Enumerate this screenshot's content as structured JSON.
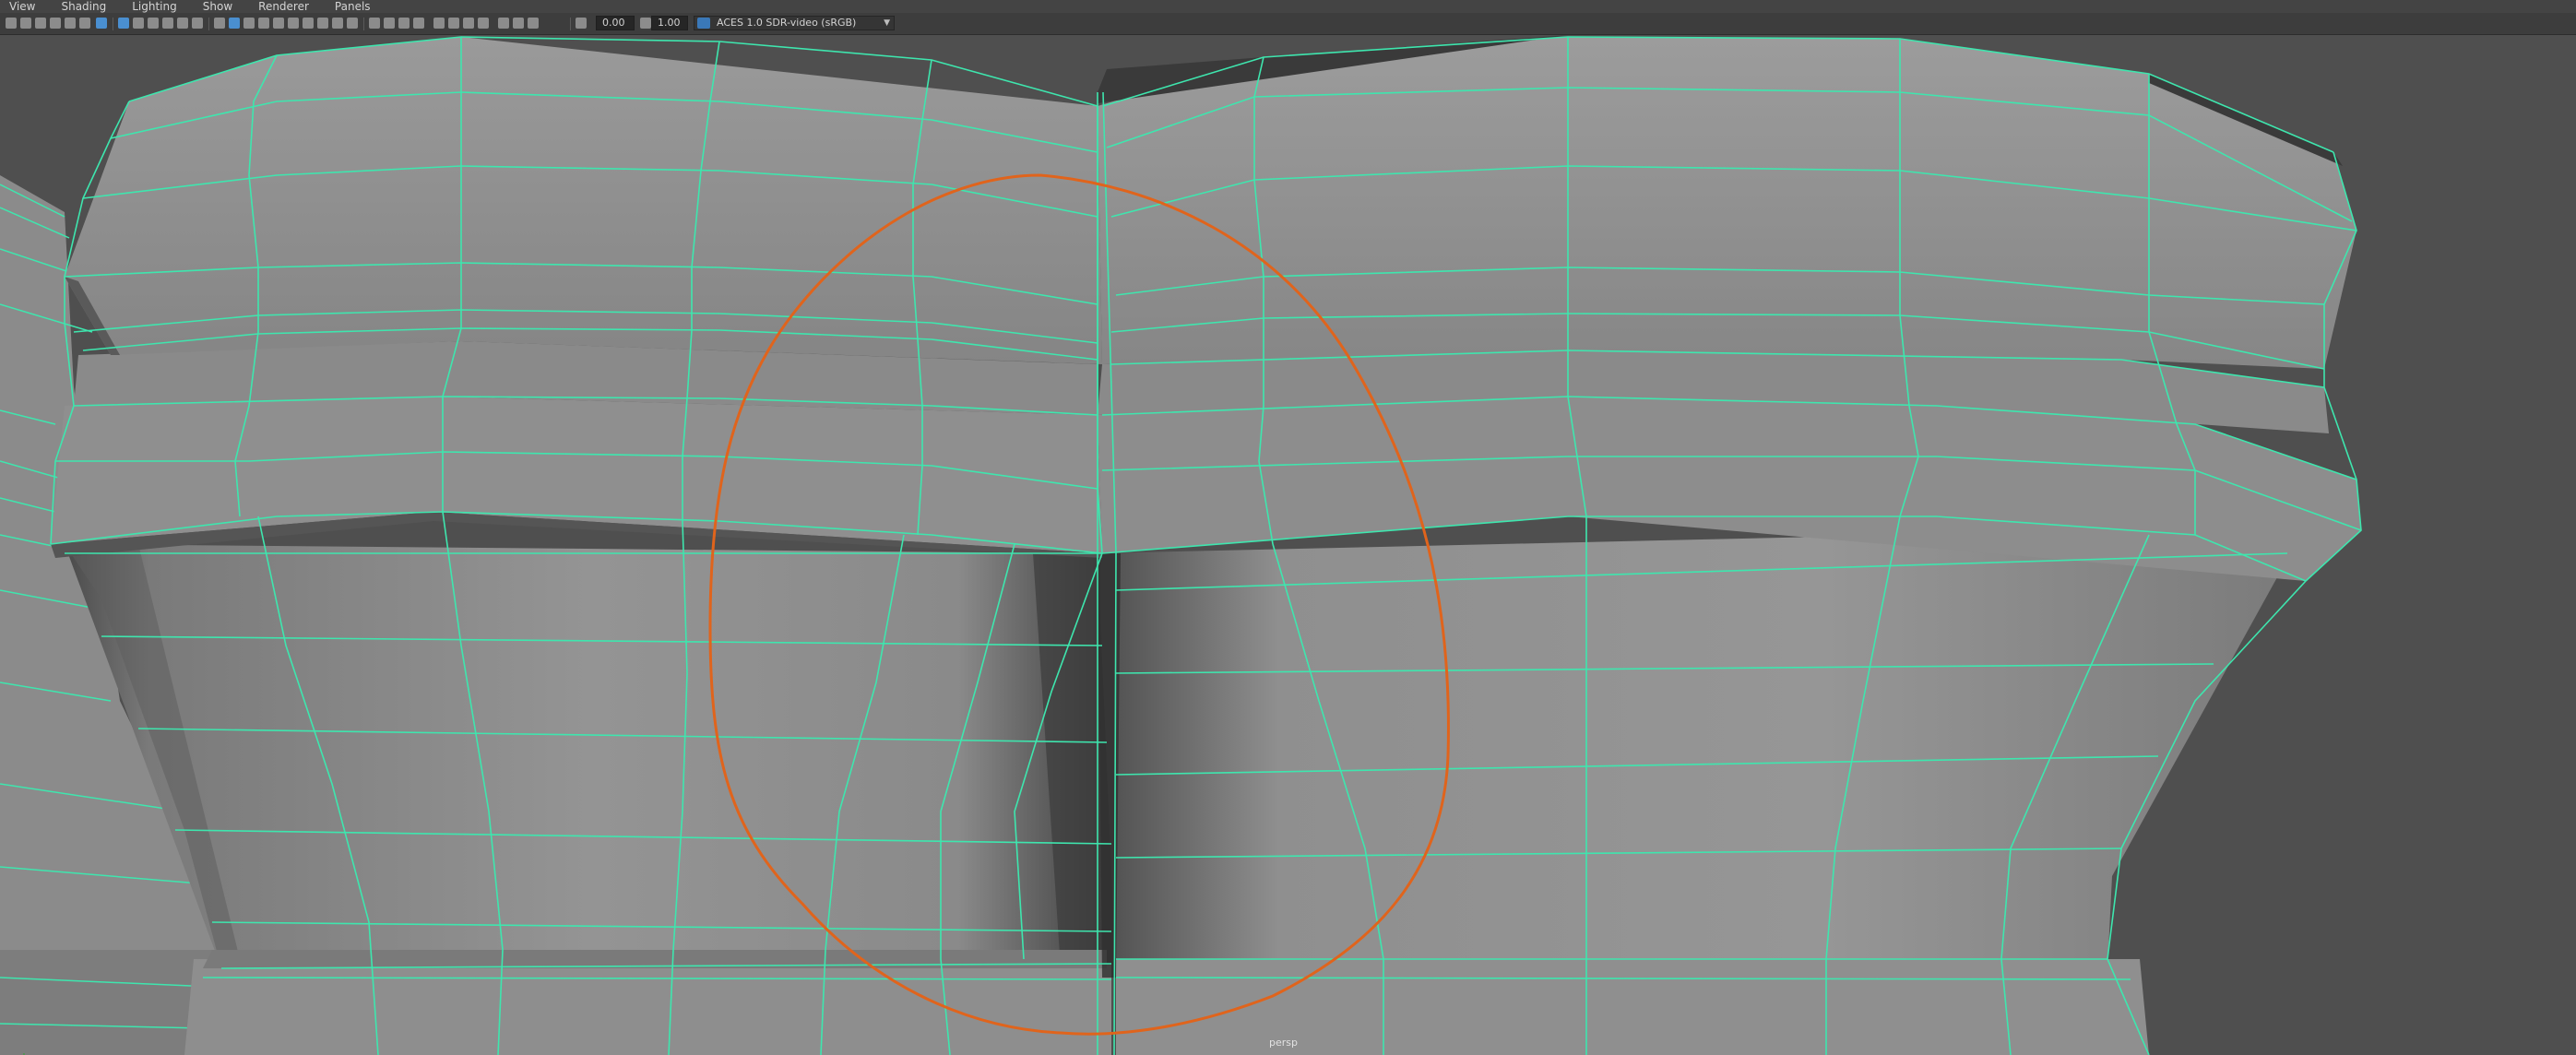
{
  "menu": {
    "items": [
      "View",
      "Shading",
      "Lighting",
      "Show",
      "Renderer",
      "Panels"
    ]
  },
  "toolbar": {
    "exposure_value": "0.00",
    "gamma_value": "1.00",
    "color_management": "ACES 1.0 SDR-video (sRGB)"
  },
  "viewport": {
    "camera_label": "persp"
  },
  "colors": {
    "background": "#4f4f4f",
    "wireframe": "#3ee6ae",
    "annotation_stroke": "#e0641c"
  },
  "icons": [
    "camera-icon",
    "wireframe-icon",
    "smooth-shade-icon",
    "isolate-icon",
    "xray-icon",
    "grid-icon",
    "exposure-icon",
    "gamma-icon",
    "color-management-icon"
  ]
}
